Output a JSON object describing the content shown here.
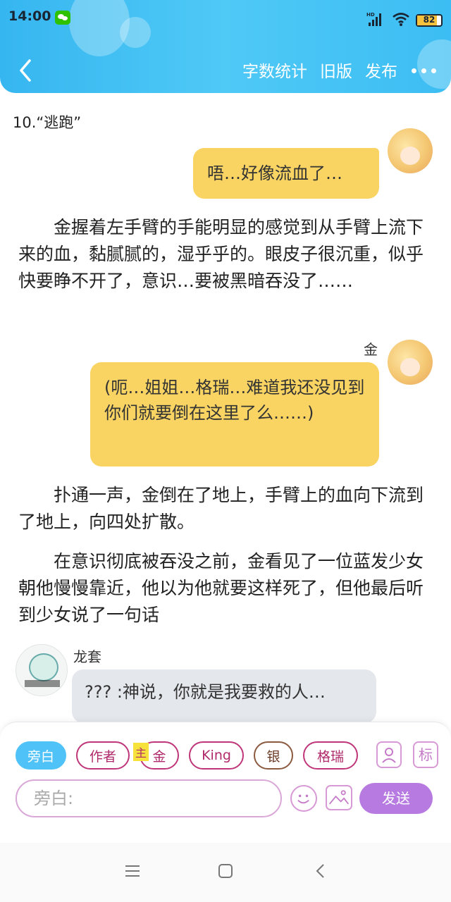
{
  "status_bar": {
    "time": "14:00",
    "battery": "82",
    "battery_level": 0.82
  },
  "nav": {
    "actions": [
      "字数统计",
      "旧版",
      "发布"
    ]
  },
  "chapter_title": "10.“逃跑”",
  "messages": {
    "m1": {
      "text": "唔…好像流血了…"
    },
    "n1": "金握着左手臂的手能明显的感觉到从手臂上流下来的血，黏腻腻的，湿乎乎的。眼皮子很沉重，似乎快要睁不开了，意识…要被黑暗吞没了……",
    "m2": {
      "sender": "金",
      "text": "(呃…姐姐…格瑞…难道我还没见到你们就要倒在这里了么……)"
    },
    "n2": "扑通一声，金倒在了地上，手臂上的血向下流到了地上，向四处扩散。",
    "n3": "在意识彻底被吞没之前，金看见了一位蓝发少女朝他慢慢靠近，他以为他就要这样死了，但他最后听到少女说了一句话",
    "m3": {
      "sender": "龙套",
      "text": "??? :神说，你就是我要救的人…"
    }
  },
  "roles": [
    "旁白",
    "作者",
    "金",
    "King",
    "银",
    "格瑞"
  ],
  "host_badge": "主",
  "tag_icon": "标",
  "input": {
    "placeholder": "旁白:"
  },
  "send_label": "发送",
  "colors": {
    "header": "#3cbdf3",
    "bubble_yellow": "#f9d463",
    "bubble_gray": "#e4e7ec",
    "role_border": "#c0367a",
    "active_role": "#4fc3f7",
    "send": "#b77ae0"
  }
}
